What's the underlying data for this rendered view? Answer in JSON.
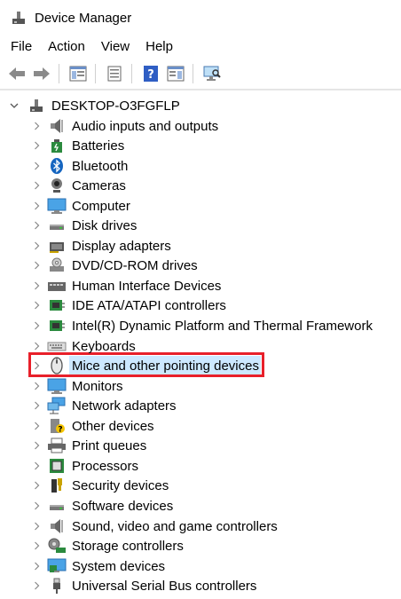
{
  "window": {
    "title": "Device Manager"
  },
  "menu": [
    "File",
    "Action",
    "View",
    "Help"
  ],
  "toolbar": {
    "buttons": [
      "back-icon",
      "forward-icon",
      "properties-pane-icon",
      "device-list-icon",
      "help-icon",
      "action-pane-icon",
      "monitor-scan-icon"
    ]
  },
  "tree": {
    "root": "DESKTOP-O3FGFLP",
    "items": [
      {
        "label": "Audio inputs and outputs",
        "icon": "speaker-icon"
      },
      {
        "label": "Batteries",
        "icon": "battery-icon"
      },
      {
        "label": "Bluetooth",
        "icon": "bluetooth-icon"
      },
      {
        "label": "Cameras",
        "icon": "camera-icon"
      },
      {
        "label": "Computer",
        "icon": "computer-icon"
      },
      {
        "label": "Disk drives",
        "icon": "disk-drive-icon"
      },
      {
        "label": "Display adapters",
        "icon": "display-adapter-icon"
      },
      {
        "label": "DVD/CD-ROM drives",
        "icon": "dvd-icon"
      },
      {
        "label": "Human Interface Devices",
        "icon": "hid-icon"
      },
      {
        "label": "IDE ATA/ATAPI controllers",
        "icon": "ide-icon"
      },
      {
        "label": "Intel(R) Dynamic Platform and Thermal Framework",
        "icon": "chip-icon"
      },
      {
        "label": "Keyboards",
        "icon": "keyboard-icon"
      },
      {
        "label": "Mice and other pointing devices",
        "icon": "mouse-icon",
        "selected": true
      },
      {
        "label": "Monitors",
        "icon": "monitor-icon"
      },
      {
        "label": "Network adapters",
        "icon": "network-icon"
      },
      {
        "label": "Other devices",
        "icon": "unknown-device-icon"
      },
      {
        "label": "Print queues",
        "icon": "printer-icon"
      },
      {
        "label": "Processors",
        "icon": "processor-icon"
      },
      {
        "label": "Security devices",
        "icon": "security-icon"
      },
      {
        "label": "Software devices",
        "icon": "software-device-icon"
      },
      {
        "label": "Sound, video and game controllers",
        "icon": "sound-icon"
      },
      {
        "label": "Storage controllers",
        "icon": "storage-icon"
      },
      {
        "label": "System devices",
        "icon": "system-icon"
      },
      {
        "label": "Universal Serial Bus controllers",
        "icon": "usb-icon"
      }
    ]
  },
  "colors": {
    "selection": "#cce8ff",
    "highlight_box": "#e8202a"
  }
}
